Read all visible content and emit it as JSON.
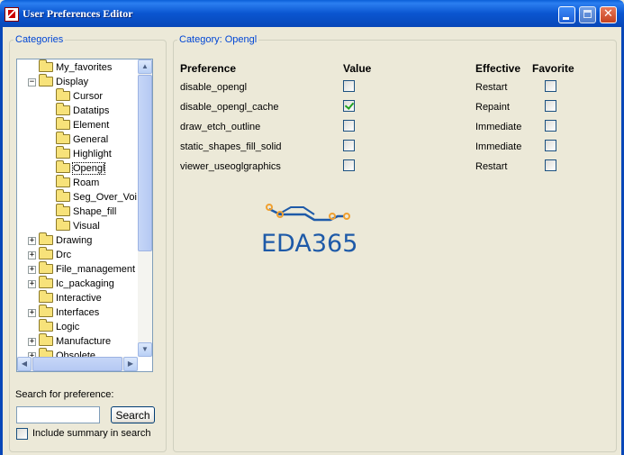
{
  "window": {
    "title": "User Preferences Editor"
  },
  "categories": {
    "legend": "Categories",
    "tree": [
      {
        "label": "My_favorites",
        "level": 0,
        "expander": ""
      },
      {
        "label": "Display",
        "level": 0,
        "expander": "−"
      },
      {
        "label": "Cursor",
        "level": 1,
        "expander": ""
      },
      {
        "label": "Datatips",
        "level": 1,
        "expander": ""
      },
      {
        "label": "Element",
        "level": 1,
        "expander": ""
      },
      {
        "label": "General",
        "level": 1,
        "expander": ""
      },
      {
        "label": "Highlight",
        "level": 1,
        "expander": ""
      },
      {
        "label": "Opengl",
        "level": 1,
        "expander": "",
        "selected": true
      },
      {
        "label": "Roam",
        "level": 1,
        "expander": ""
      },
      {
        "label": "Seg_Over_Voi",
        "level": 1,
        "expander": ""
      },
      {
        "label": "Shape_fill",
        "level": 1,
        "expander": ""
      },
      {
        "label": "Visual",
        "level": 1,
        "expander": ""
      },
      {
        "label": "Drawing",
        "level": 0,
        "expander": "+"
      },
      {
        "label": "Drc",
        "level": 0,
        "expander": "+"
      },
      {
        "label": "File_management",
        "level": 0,
        "expander": "+"
      },
      {
        "label": "Ic_packaging",
        "level": 0,
        "expander": "+"
      },
      {
        "label": "Interactive",
        "level": 0,
        "expander": ""
      },
      {
        "label": "Interfaces",
        "level": 0,
        "expander": "+"
      },
      {
        "label": "Logic",
        "level": 0,
        "expander": ""
      },
      {
        "label": "Manufacture",
        "level": 0,
        "expander": "+"
      },
      {
        "label": "Obsolete",
        "level": 0,
        "expander": "+"
      }
    ]
  },
  "search": {
    "label": "Search for preference:",
    "value": "",
    "button_label": "Search",
    "include_summary_label": "Include summary in search",
    "include_summary_checked": false
  },
  "panel": {
    "legend": "Category:  Opengl",
    "headers": {
      "preference": "Preference",
      "value": "Value",
      "effective": "Effective",
      "favorite": "Favorite"
    },
    "rows": [
      {
        "preference": "disable_opengl",
        "value": false,
        "effective": "Restart",
        "favorite": false
      },
      {
        "preference": "disable_opengl_cache",
        "value": true,
        "effective": "Repaint",
        "favorite": false
      },
      {
        "preference": "draw_etch_outline",
        "value": false,
        "effective": "Immediate",
        "favorite": false
      },
      {
        "preference": "static_shapes_fill_solid",
        "value": false,
        "effective": "Immediate",
        "favorite": false
      },
      {
        "preference": "viewer_useoglgraphics",
        "value": false,
        "effective": "Restart",
        "favorite": false
      }
    ]
  },
  "watermark": {
    "text": "EDA365",
    "color": "#1e5aa8",
    "accent": "#f0a030"
  },
  "colors": {
    "titlebar": "#0a55d0",
    "legend": "#0046d5",
    "face": "#ece9d8"
  }
}
